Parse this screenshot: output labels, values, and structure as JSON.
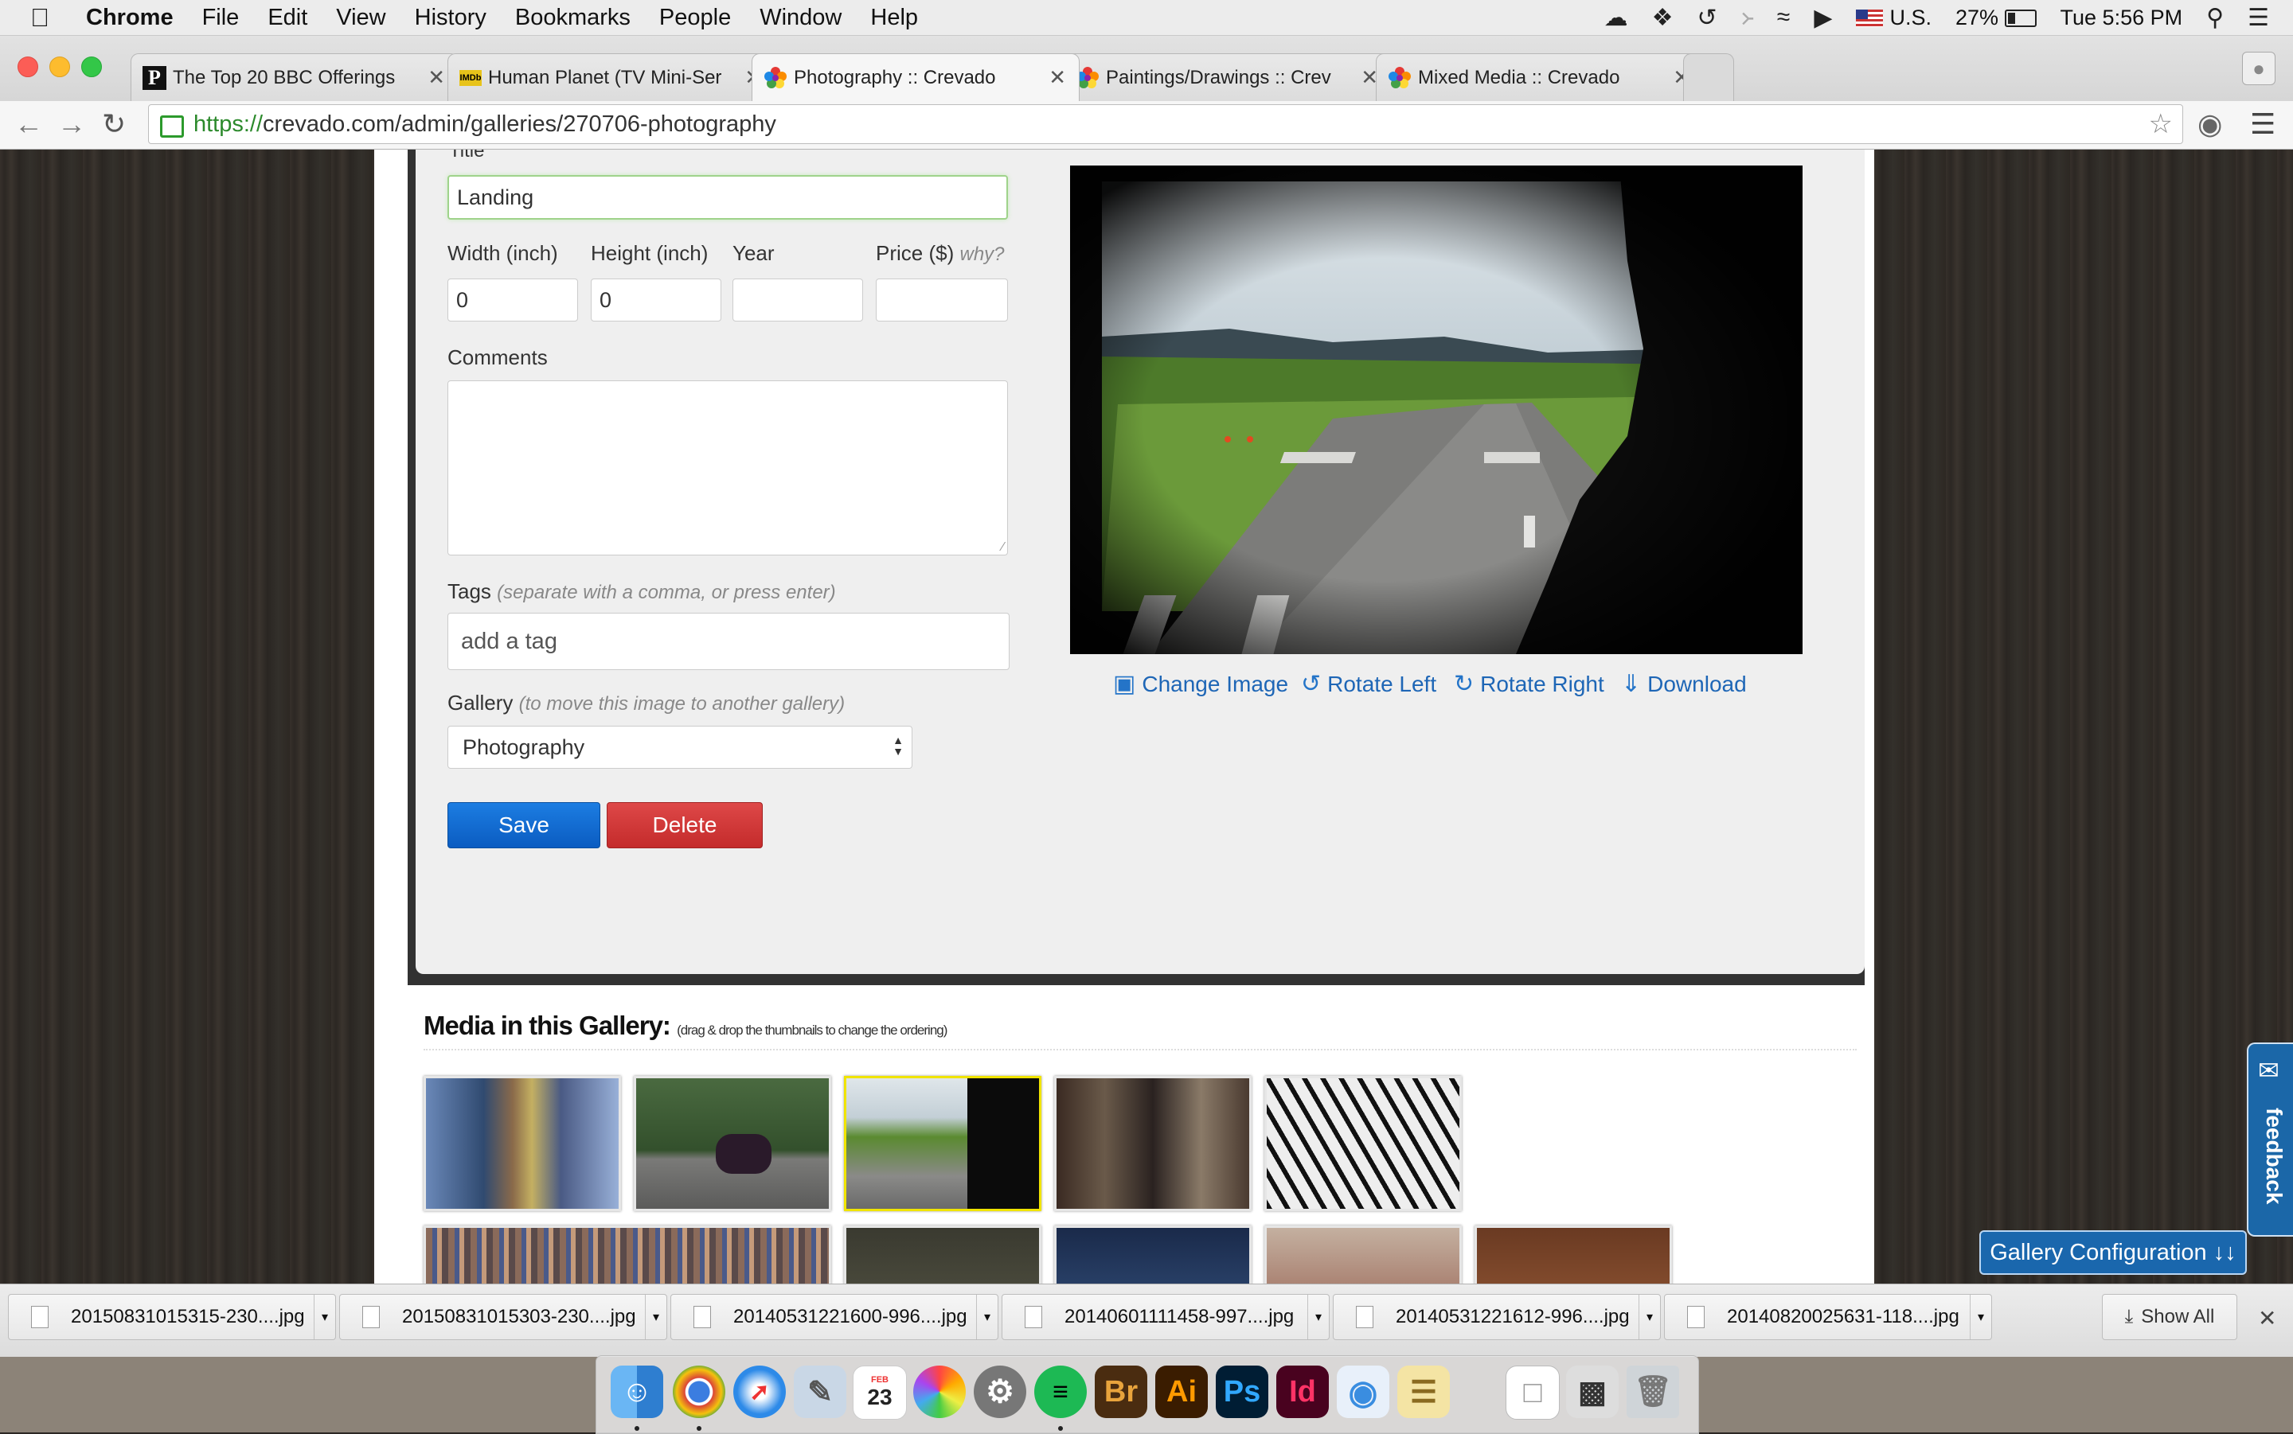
{
  "menubar": {
    "apple": "",
    "app": "Chrome",
    "items": [
      "File",
      "Edit",
      "View",
      "History",
      "Bookmarks",
      "People",
      "Window",
      "Help"
    ],
    "status": {
      "input": "U.S.",
      "battery": "27%",
      "clock": "Tue 5:56 PM"
    }
  },
  "tabs": [
    {
      "title": "The Top 20 BBC Offerings",
      "favicon": "P"
    },
    {
      "title": "Human Planet (TV Mini-Ser",
      "favicon": "IMDb"
    },
    {
      "title": "Photography :: Crevado",
      "favicon": "crevado"
    },
    {
      "title": "Paintings/Drawings :: Crev",
      "favicon": "crevado"
    },
    {
      "title": "Mixed Media :: Crevado",
      "favicon": "crevado"
    }
  ],
  "address": {
    "scheme": "https://",
    "rest": "crevado.com/admin/galleries/270706-photography"
  },
  "form": {
    "title_label": "Title",
    "title_value": "Landing",
    "width_label": "Width (inch)",
    "width_value": "0",
    "height_label": "Height (inch)",
    "height_value": "0",
    "year_label": "Year",
    "year_value": "",
    "price_label": "Price ($)",
    "price_hint": "why?",
    "price_value": "",
    "comments_label": "Comments",
    "tags_label": "Tags",
    "tags_hint": "(separate with a comma, or press enter)",
    "tags_placeholder": "add a tag",
    "gallery_label": "Gallery",
    "gallery_hint": "(to move this image to another gallery)",
    "gallery_value": "Photography",
    "save_label": "Save",
    "delete_label": "Delete"
  },
  "image_actions": {
    "change": "Change Image",
    "rotate_left": "Rotate Left",
    "rotate_right": "Rotate Right",
    "download": "Download"
  },
  "gallery": {
    "title": "Media in this Gallery:",
    "hint": "(drag & drop the thumbnails to change the ordering)",
    "selected_index": 2
  },
  "feedback_label": "feedback",
  "gallery_config_label": "Gallery Configuration ↓↓",
  "downloads": [
    "20150831015315-230....jpg",
    "20150831015303-230....jpg",
    "20140531221600-996....jpg",
    "20140601111458-997....jpg",
    "20140531221612-996....jpg",
    "20140820025631-118....jpg"
  ],
  "downloads_show_all": "Show All",
  "dock": {
    "apps": [
      "Finder",
      "Chrome",
      "Safari",
      "Preview",
      "Calendar",
      "Photos",
      "System Preferences",
      "Spotify",
      "Br",
      "Ai",
      "Ps",
      "Id",
      "Messages",
      "Notes",
      "Document",
      "Screenshot",
      "Trash"
    ],
    "calendar_month": "FEB",
    "calendar_day": "23"
  },
  "colors": {
    "link": "#1e66b6",
    "save": "#0b5cc1",
    "delete": "#c42b2b",
    "focus": "#9fd38b",
    "feedback": "#1b67a8"
  }
}
